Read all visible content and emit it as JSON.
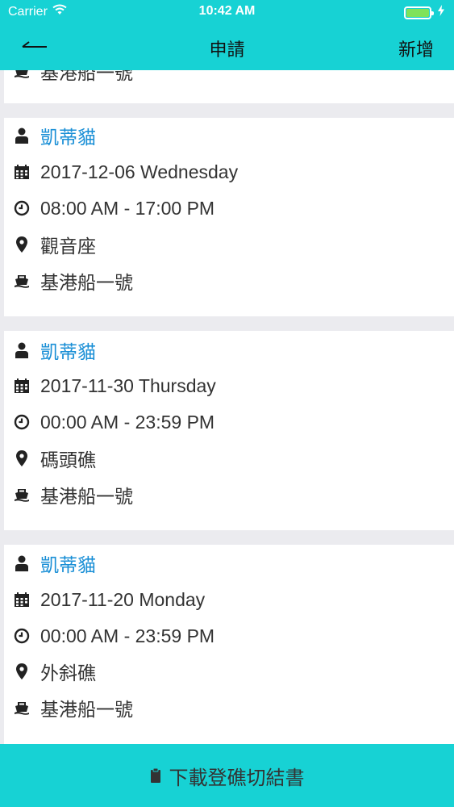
{
  "status": {
    "carrier": "Carrier",
    "time": "10:42 AM"
  },
  "nav": {
    "title": "申請",
    "add_label": "新增"
  },
  "partial_card": {
    "ship": "基港船一號"
  },
  "cards": [
    {
      "name": "凱蒂貓",
      "date": "2017-12-06 Wednesday",
      "time": "08:00 AM - 17:00 PM",
      "location": "觀音座",
      "ship": "基港船一號"
    },
    {
      "name": "凱蒂貓",
      "date": "2017-11-30 Thursday",
      "time": "00:00 AM - 23:59 PM",
      "location": "碼頭礁",
      "ship": "基港船一號"
    },
    {
      "name": "凱蒂貓",
      "date": "2017-11-20 Monday",
      "time": "00:00 AM - 23:59 PM",
      "location": "外斜礁",
      "ship": "基港船一號"
    }
  ],
  "footer": {
    "label": "下載登礁切結書"
  },
  "colors": {
    "accent": "#17d2d4",
    "name_link": "#1a8fd6",
    "background": "#ebebef"
  }
}
